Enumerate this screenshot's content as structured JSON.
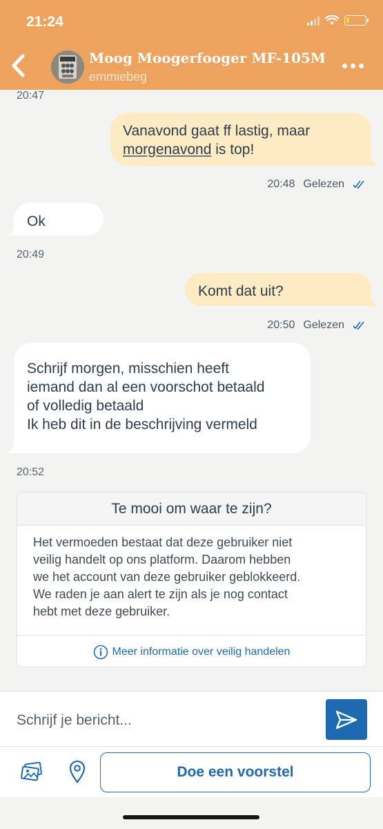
{
  "status_bar": {
    "time": "21:24"
  },
  "header": {
    "title": "Moog Moogerfooger MF-105M",
    "subtitle": "emmiebeg"
  },
  "messages": [
    {
      "timestamp_above": "20:47"
    },
    {
      "direction": "out",
      "line1": "Vanavond gaat ff lastig, maar",
      "line2_underlined": "morgenavond",
      "line2_rest": " is top!",
      "time": "20:48",
      "status": "Gelezen"
    },
    {
      "direction": "in",
      "text": "Ok",
      "time": "20:49"
    },
    {
      "direction": "out",
      "text": "Komt dat uit?",
      "time": "20:50",
      "status": "Gelezen"
    },
    {
      "direction": "in",
      "lines": [
        "Schrijf morgen, misschien heeft",
        "iemand dan al een voorschot betaald",
        "of volledig betaald",
        "Ik heb dit in de beschrijving vermeld"
      ],
      "time": "20:52"
    }
  ],
  "warning_card": {
    "title": "Te mooi om waar te zijn?",
    "body_lines": [
      "Het vermoeden bestaat dat deze gebruiker niet",
      "veilig handelt op ons platform. Daarom hebben",
      "we het account van deze gebruiker geblokkeerd.",
      "We raden je aan alert te zijn als je nog contact",
      "hebt met deze gebruiker."
    ],
    "link": "Meer informatie over veilig handelen"
  },
  "composer": {
    "placeholder": "Schrijf je bericht...",
    "offer_button": "Doe een voorstel"
  },
  "colors": {
    "header": "#eda35e",
    "accent": "#1e6ab0",
    "outgoing_bubble": "#fdebc4"
  }
}
